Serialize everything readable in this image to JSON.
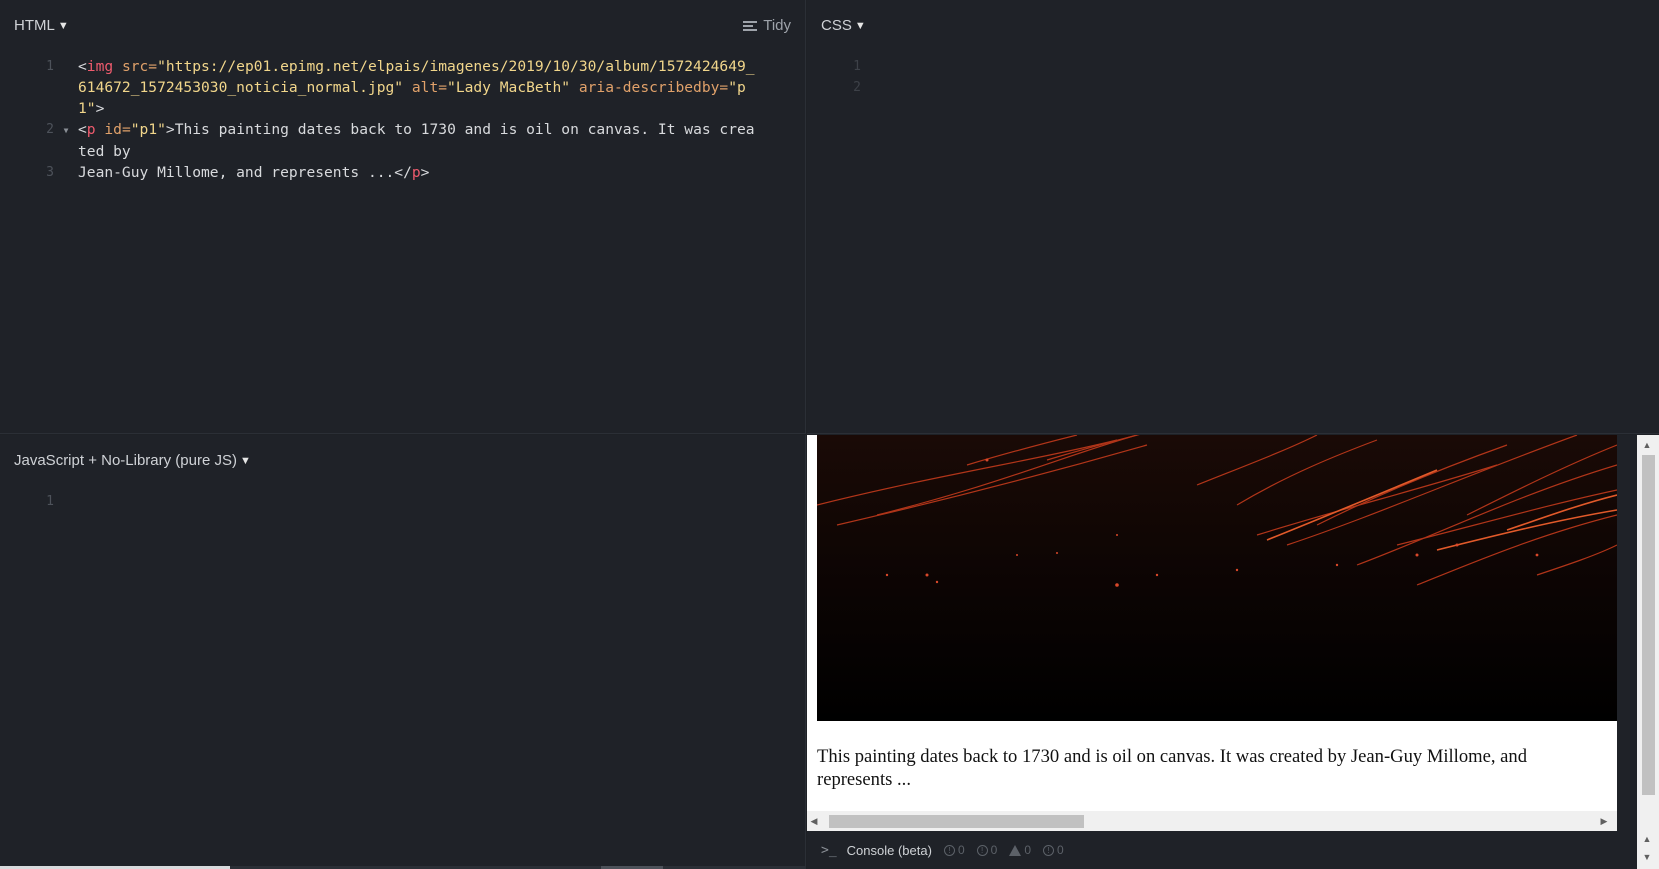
{
  "html_panel": {
    "title": "HTML",
    "tidy_label": "Tidy",
    "line_numbers": [
      "1",
      "2",
      "3"
    ],
    "code": {
      "l1_open": "<",
      "l1_tag": "img",
      "l1_attr1": " src=",
      "l1_src_a": "\"https://ep01.epimg.net/elpais/imagenes/2019/10/30/album/1572424649_",
      "l1_src_b": "614672_1572453030_noticia_normal.jpg\"",
      "l1_attr2": " alt=",
      "l1_alt": "\"Lady MacBeth\"",
      "l1_attr3": " aria-describedby=",
      "l1_desc_a": "\"p",
      "l1_desc_b": "1\"",
      "l1_close": ">",
      "l2_open": "<",
      "l2_tag": "p",
      "l2_attr": " id=",
      "l2_id": "\"p1\"",
      "l2_text_a": ">This painting dates back to 1730 and is oil on canvas. It was crea",
      "l2_text_b": "ted by",
      "l3_text": "Jean-Guy Millome, and represents ...</",
      "l3_tag": "p",
      "l3_close": ">"
    }
  },
  "css_panel": {
    "title": "CSS",
    "line_numbers": [
      "1",
      "2"
    ]
  },
  "js_panel": {
    "title": "JavaScript + No-Library (pure JS)",
    "line_numbers": [
      "1"
    ]
  },
  "result": {
    "image_alt": "Lady MacBeth",
    "caption": "This painting dates back to 1730 and is oil on canvas. It was created by Jean-Guy Millome, and represents ...",
    "console_label": "Console (beta)",
    "counters": [
      "0",
      "0",
      "0",
      "0"
    ]
  }
}
